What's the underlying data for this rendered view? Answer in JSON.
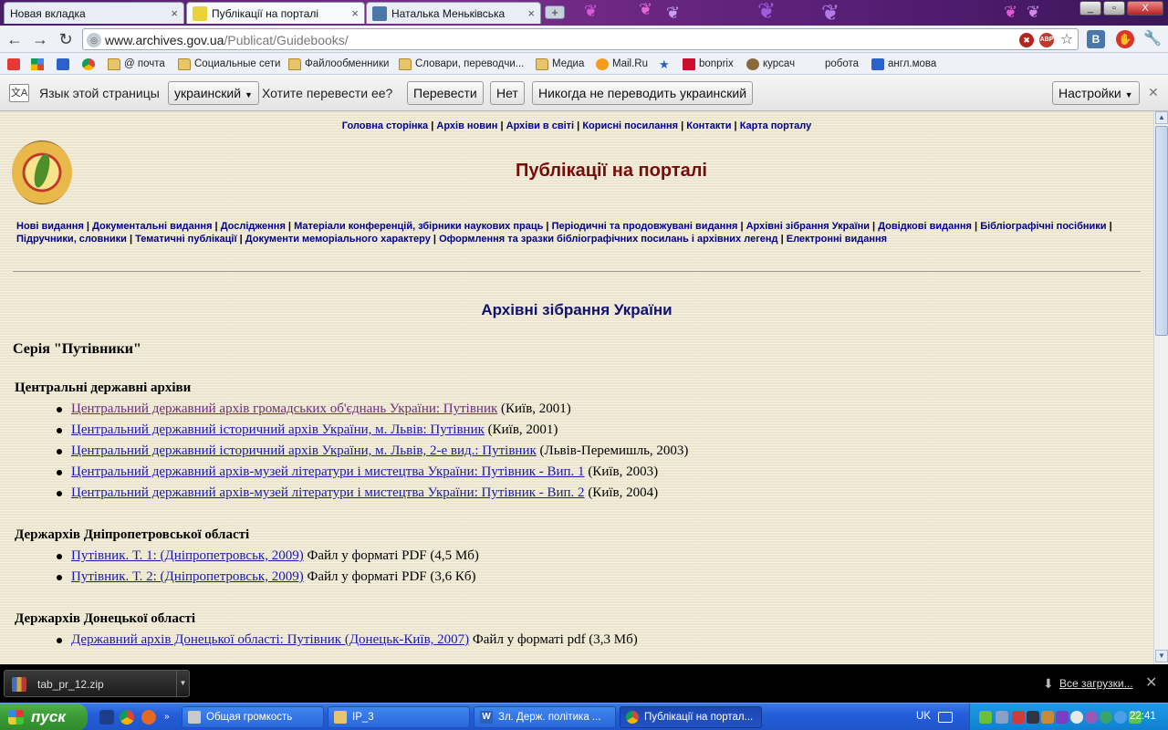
{
  "browser": {
    "tabs": [
      {
        "label": "Новая вкладка",
        "favicon_color": "#cfd6e2"
      },
      {
        "label": "Публікації на порталі",
        "favicon_color": "#e8d43a"
      },
      {
        "label": "Наталька Меньківська",
        "favicon_color": "#4a76a8"
      }
    ],
    "tab_close_glyph": "×",
    "new_tab_glyph": "+",
    "window_controls": {
      "minimize": "_",
      "maximize": "▫",
      "close": "X"
    },
    "url_host": "www.archives.gov.ua",
    "url_path": "/Publicat/Guidebooks/",
    "bookmarks": [
      {
        "label": "",
        "icon": "yandex-icon"
      },
      {
        "label": "",
        "icon": "google-icon"
      },
      {
        "label": "",
        "icon": "mailru-agent-icon"
      },
      {
        "label": "",
        "icon": "chrome-icon"
      },
      {
        "label": "@ почта",
        "icon": "folder-icon"
      },
      {
        "label": "Социальные сети",
        "icon": "folder-icon"
      },
      {
        "label": "Файлообменники",
        "icon": "folder-icon"
      },
      {
        "label": "Словари, переводчи...",
        "icon": "folder-icon"
      },
      {
        "label": "Медиа",
        "icon": "folder-icon"
      },
      {
        "label": "Mail.Ru",
        "icon": "mailru-icon"
      },
      {
        "label": "",
        "icon": "star-icon"
      },
      {
        "label": "bonprix",
        "icon": "bonprix-icon"
      },
      {
        "label": "курсач",
        "icon": "owl-icon"
      },
      {
        "label": "робота",
        "icon": "blank-icon"
      },
      {
        "label": "англ.мова",
        "icon": "vk-icon"
      }
    ],
    "translate_bar": {
      "lang_label": "Язык этой страницы",
      "language": "украинский",
      "question": "Хотите перевести ее?",
      "translate_btn": "Перевести",
      "no_btn": "Нет",
      "never_btn": "Никогда не переводить украинский",
      "settings_btn": "Настройки",
      "close_glyph": "✕"
    }
  },
  "page": {
    "top_nav": [
      "Головна сторінка",
      "Архів новин",
      "Архіви в світі",
      "Корисні посилання",
      "Контакти",
      "Карта порталу"
    ],
    "site_title": "Публікації на порталі",
    "section_nav_line1": [
      "Нові видання",
      "Документальні видання",
      "Дослідження",
      "Матеріали конференцій, збірники наукових праць",
      "Періодичні та продовжувані видання",
      "Архівні зібрання України",
      "Довідкові видання",
      "Бібліографічні посібники"
    ],
    "section_nav_line2": [
      "Підручники, словники",
      "Тематичні публікації",
      "Документи меморіального характеру",
      "Оформлення та зразки бібліографічних посилань і архівних легенд",
      "Електронні видання"
    ],
    "section_title": "Архівні зібрання України",
    "series": "Серія \"Путівники\"",
    "groups": [
      {
        "heading": "Центральні державні архіви",
        "items": [
          {
            "link": "Центральний державний архів громадських об'єднань України: Путівник",
            "suffix": " (Київ, 2001)"
          },
          {
            "link": "Центральний державний історичний архів України, м. Львів: Путівник",
            "suffix": " (Київ, 2001)"
          },
          {
            "link": "Центральний державний історичний архів України, м. Львів, 2-е вид.: Путівник",
            "suffix": " (Львів-Перемишль, 2003)"
          },
          {
            "link": "Центральний державний архів-музей літератури і мистецтва України: Путівник - Вип. 1",
            "suffix": " (Київ, 2003)"
          },
          {
            "link": "Центральний державний архів-музей літератури і мистецтва України: Путівник - Вип. 2",
            "suffix": " (Київ, 2004)"
          }
        ]
      },
      {
        "heading": "Держархів Дніпропетровської області",
        "items": [
          {
            "link": "Путівник. Т. 1: (Дніпропетровськ, 2009)",
            "suffix": " Файл у форматі PDF (4,5 Мб)"
          },
          {
            "link": "Путівник. Т. 2: (Дніпропетровськ, 2009)",
            "suffix": " Файл у форматі PDF (3,6 Кб)"
          }
        ]
      },
      {
        "heading": "Держархів Донецької області",
        "items": [
          {
            "link": "Державний архів Донецької області: Путівник (Донецьк-Київ, 2007)",
            "suffix": " Файл у форматі pdf (3,3 Мб)"
          }
        ]
      }
    ]
  },
  "downloads": {
    "file": "tab_pr_12.zip",
    "show_all": "Все загрузки..."
  },
  "taskbar": {
    "start": "пуск",
    "tasks": [
      {
        "label": "Общая громкость",
        "icon_color": "#c9c9c9"
      },
      {
        "label": "IP_3",
        "icon_color": "#e8c46a"
      },
      {
        "label": "Зл. Держ. політика ...",
        "icon_color": "#2b5fb8"
      },
      {
        "label": "Публікації на портал...",
        "icon_color": "#db4437"
      }
    ],
    "lang": "UK",
    "clock": "22:41"
  }
}
